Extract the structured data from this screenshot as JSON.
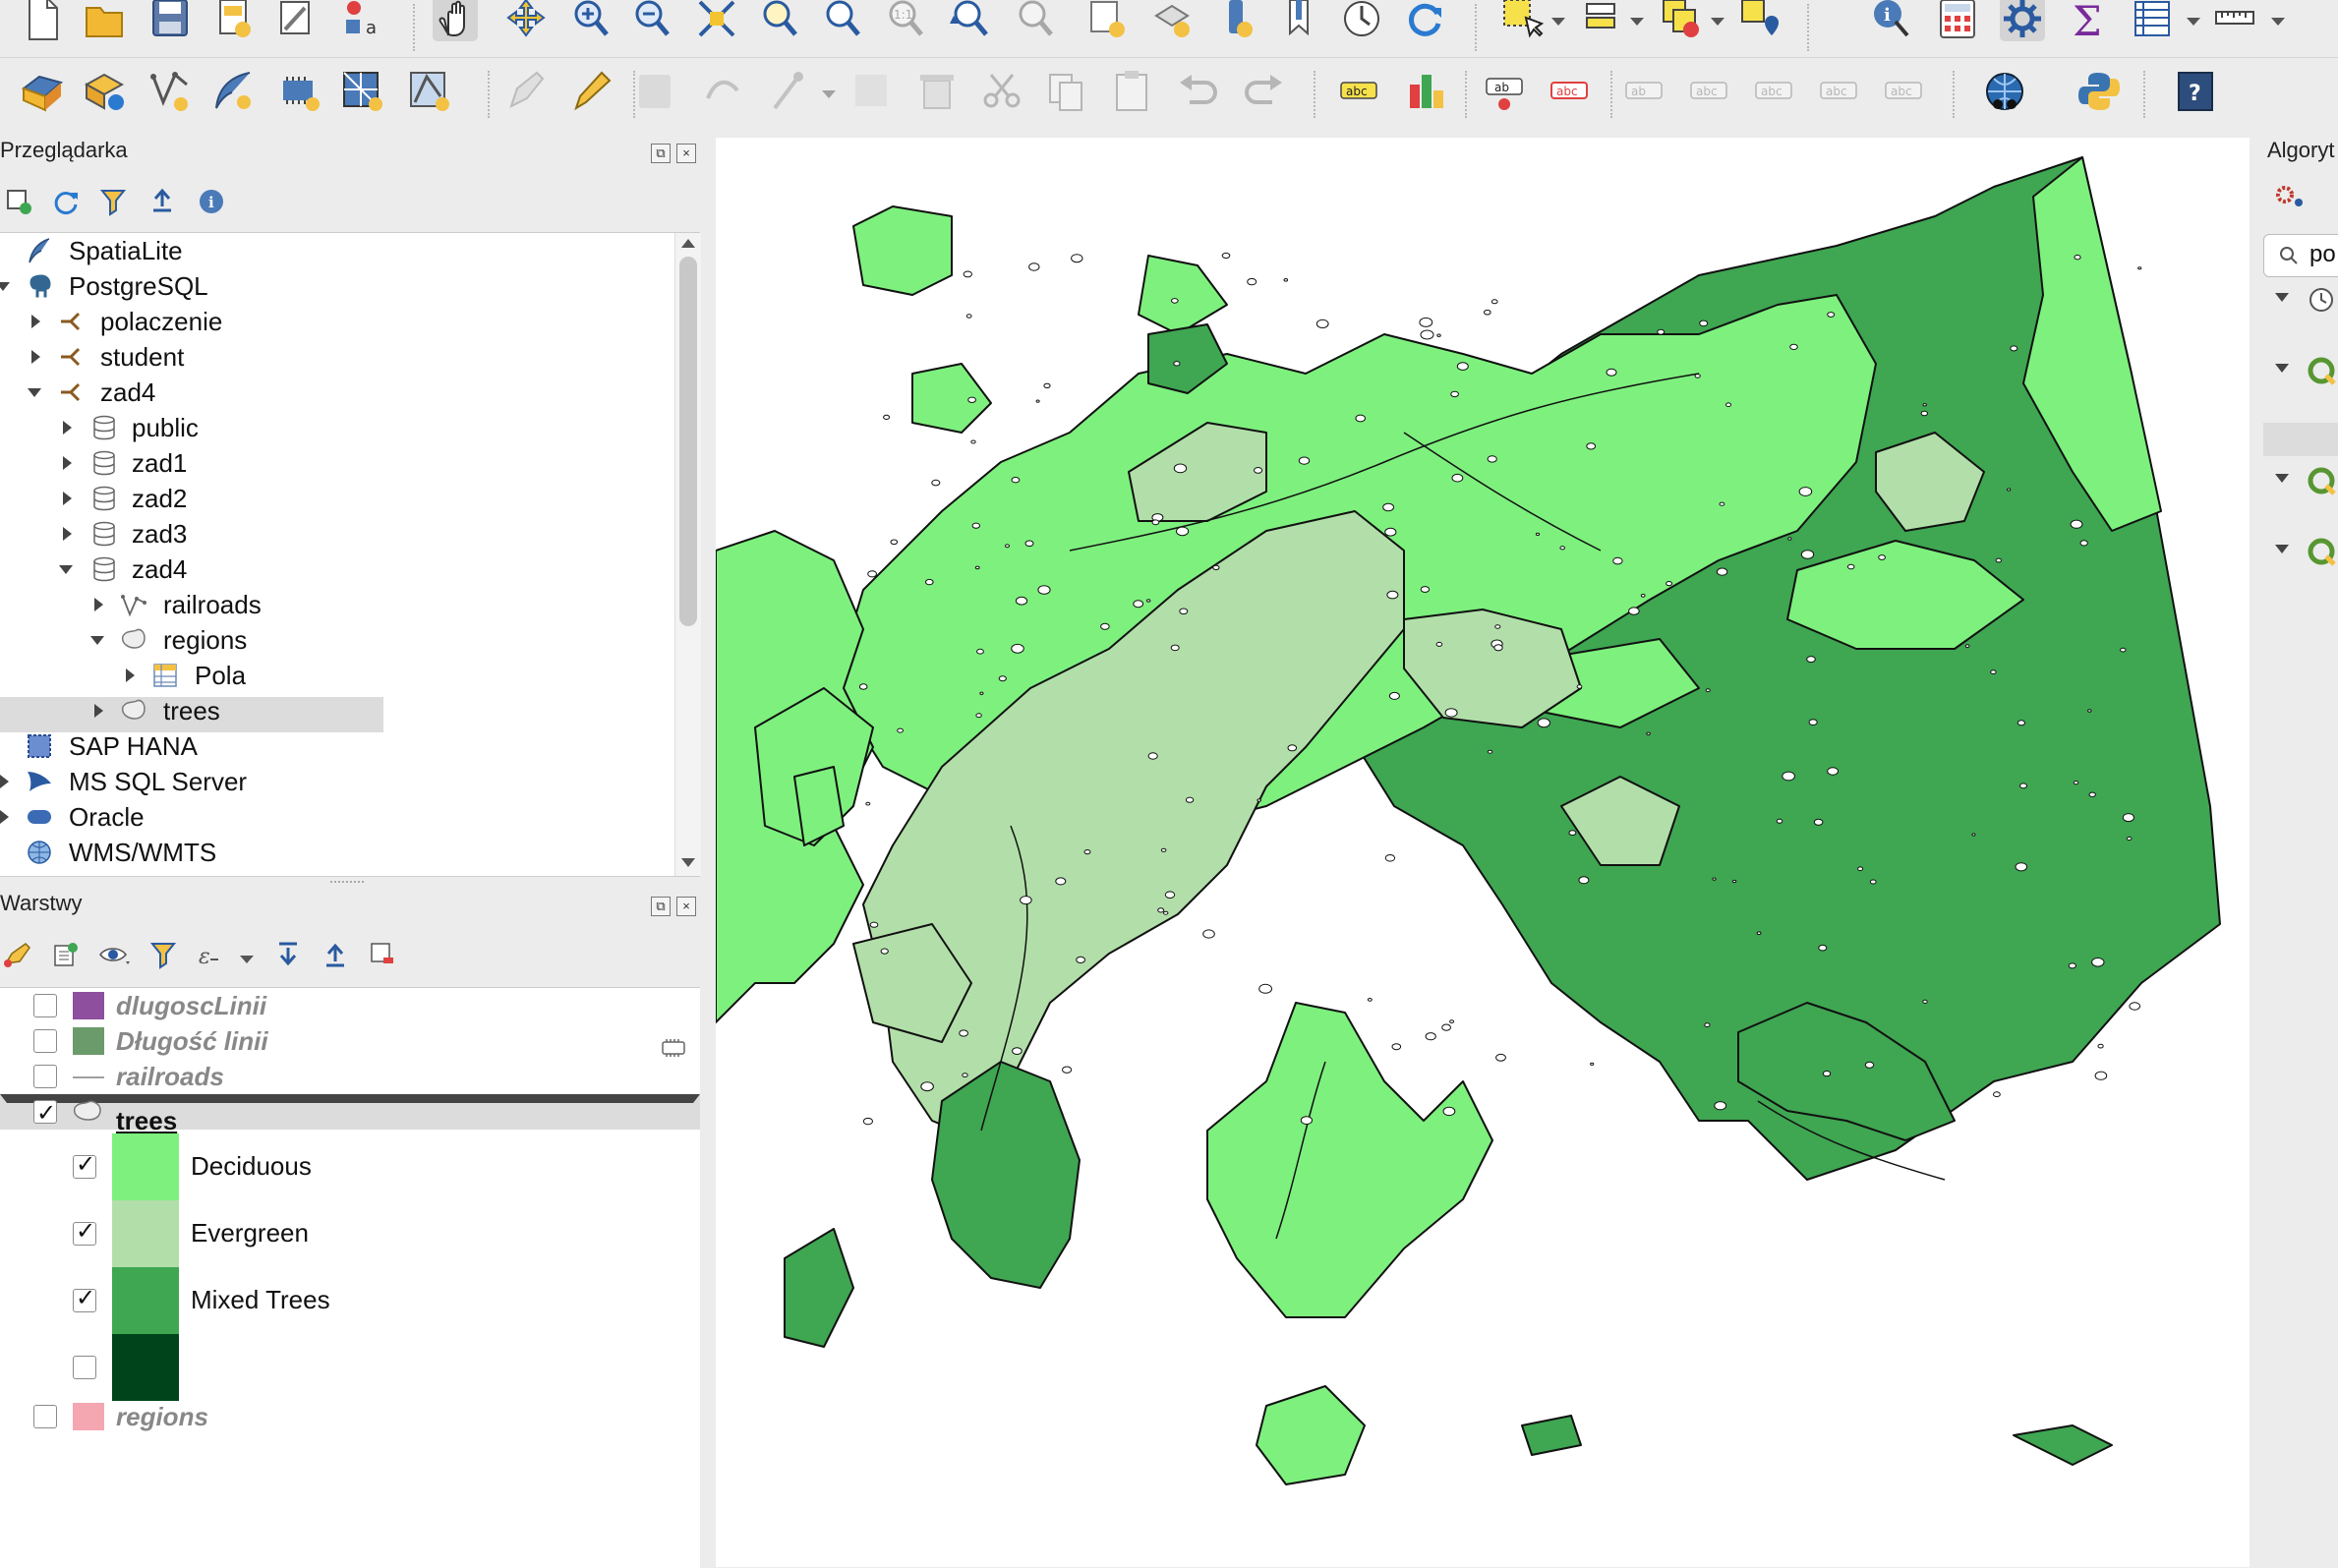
{
  "browser_panel": {
    "title": "Przeglądarka",
    "items": [
      {
        "label": "SpatiaLite",
        "icon": "feather-icon"
      },
      {
        "label": "PostgreSQL",
        "icon": "elephant-icon"
      },
      {
        "label": "polaczenie",
        "icon": "connection-icon"
      },
      {
        "label": "student",
        "icon": "connection-icon"
      },
      {
        "label": "zad4",
        "icon": "connection-icon"
      },
      {
        "label": "public",
        "icon": "schema-icon"
      },
      {
        "label": "zad1",
        "icon": "schema-icon"
      },
      {
        "label": "zad2",
        "icon": "schema-icon"
      },
      {
        "label": "zad3",
        "icon": "schema-icon"
      },
      {
        "label": "zad4",
        "icon": "schema-icon"
      },
      {
        "label": "railroads",
        "icon": "line-layer-icon"
      },
      {
        "label": "regions",
        "icon": "polygon-layer-icon"
      },
      {
        "label": "Pola",
        "icon": "table-icon"
      },
      {
        "label": "trees",
        "icon": "polygon-layer-icon"
      },
      {
        "label": "SAP HANA",
        "icon": "sap-hana-icon"
      },
      {
        "label": "MS SQL Server",
        "icon": "mssql-icon"
      },
      {
        "label": "Oracle",
        "icon": "oracle-icon"
      },
      {
        "label": "WMS/WMTS",
        "icon": "globe-icon"
      }
    ]
  },
  "layers_panel": {
    "title": "Warstwy",
    "layers": [
      {
        "label": "dlugoscLinii",
        "checked": false,
        "color": "#8e4f9e"
      },
      {
        "label": "Długość linii",
        "checked": false,
        "color": "#6b9a6b"
      },
      {
        "label": "railroads",
        "checked": false,
        "color": "#a0a0a0"
      },
      {
        "label": "trees",
        "checked": true,
        "color": "#ffffff"
      },
      {
        "label": "regions",
        "checked": false,
        "color": "#f4a7b1"
      }
    ],
    "categories": [
      {
        "label": "Deciduous",
        "checked": true,
        "color": "#7ef07e"
      },
      {
        "label": "Evergreen",
        "checked": true,
        "color": "#b2dfa9"
      },
      {
        "label": "Mixed Trees",
        "checked": true,
        "color": "#3fa652"
      },
      {
        "label": "",
        "checked": false,
        "color": "#00441b"
      }
    ]
  },
  "processing_panel": {
    "title": "Algoryt",
    "search_value": "po"
  },
  "map_colors": {
    "deciduous": "#7ef07e",
    "evergreen": "#b2dfa9",
    "mixed": "#3fa652",
    "dark_mixed": "#2e8b45"
  }
}
